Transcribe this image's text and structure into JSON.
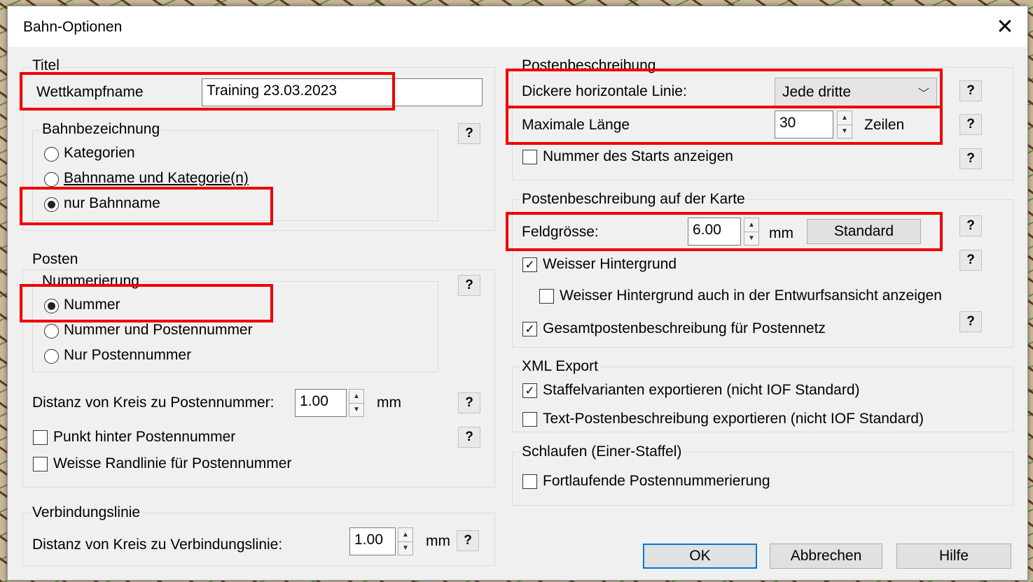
{
  "window": {
    "title": "Bahn-Optionen",
    "close_glyph": "✕"
  },
  "titel": {
    "legend": "Titel",
    "wettkampfname_label": "Wettkampfname",
    "wettkampfname_value": "Training 23.03.2023",
    "bahnbezeichnung": {
      "legend": "Bahnbezeichnung",
      "options": [
        "Kategorien",
        "Bahnname und Kategorie(n)",
        "nur Bahnname"
      ],
      "selected_index": 2
    }
  },
  "posten": {
    "legend": "Posten",
    "nummerierung": {
      "legend": "Nummerierung",
      "options": [
        "Nummer",
        "Nummer und Postennummer",
        "Nur Postennummer"
      ],
      "selected_index": 0
    },
    "distanz_label": "Distanz von Kreis zu Postennummer:",
    "distanz_value": "1.00",
    "distanz_unit": "mm",
    "punkt_label": "Punkt hinter Postennummer",
    "randlinie_label": "Weisse Randlinie für Postennummer"
  },
  "verbindungslinie": {
    "legend": "Verbindungslinie",
    "distanz_label": "Distanz von Kreis zu Verbindungslinie:",
    "distanz_value": "1.00",
    "distanz_unit": "mm"
  },
  "postenbeschreibung": {
    "legend": "Postenbeschreibung",
    "dickere_label": "Dickere horizontale Linie:",
    "dickere_value": "Jede dritte",
    "maximale_label": "Maximale Länge",
    "maximale_value": "30",
    "maximale_unit": "Zeilen",
    "nummer_starts_label": "Nummer des Starts anzeigen"
  },
  "auf_karte": {
    "legend": "Postenbeschreibung auf der Karte",
    "feldgroesse_label": "Feldgrösse:",
    "feldgroesse_value": "6.00",
    "feldgroesse_unit": "mm",
    "standard_button": "Standard",
    "weisser_label": "Weisser Hintergrund",
    "weisser_entwurf_label": "Weisser Hintergrund auch in der Entwurfsansicht anzeigen",
    "gesamt_label": "Gesamtpostenbeschreibung für Postennetz"
  },
  "xml_export": {
    "legend": "XML Export",
    "staffel_label": "Staffelvarianten exportieren (nicht IOF Standard)",
    "text_label": "Text-Postenbeschreibung exportieren (nicht IOF Standard)"
  },
  "schlaufen": {
    "legend": "Schlaufen (Einer-Staffel)",
    "fortlaufend_label": "Fortlaufende Postennummerierung"
  },
  "buttons": {
    "ok": "OK",
    "abbrechen": "Abbrechen",
    "hilfe": "Hilfe"
  },
  "help_glyph": "?",
  "check_glyph": "✓",
  "spin_up": "▲",
  "spin_down": "▼",
  "combo_chevron": "﹀",
  "colors": {
    "highlight": "#ee0000",
    "focus": "#0078d7"
  }
}
